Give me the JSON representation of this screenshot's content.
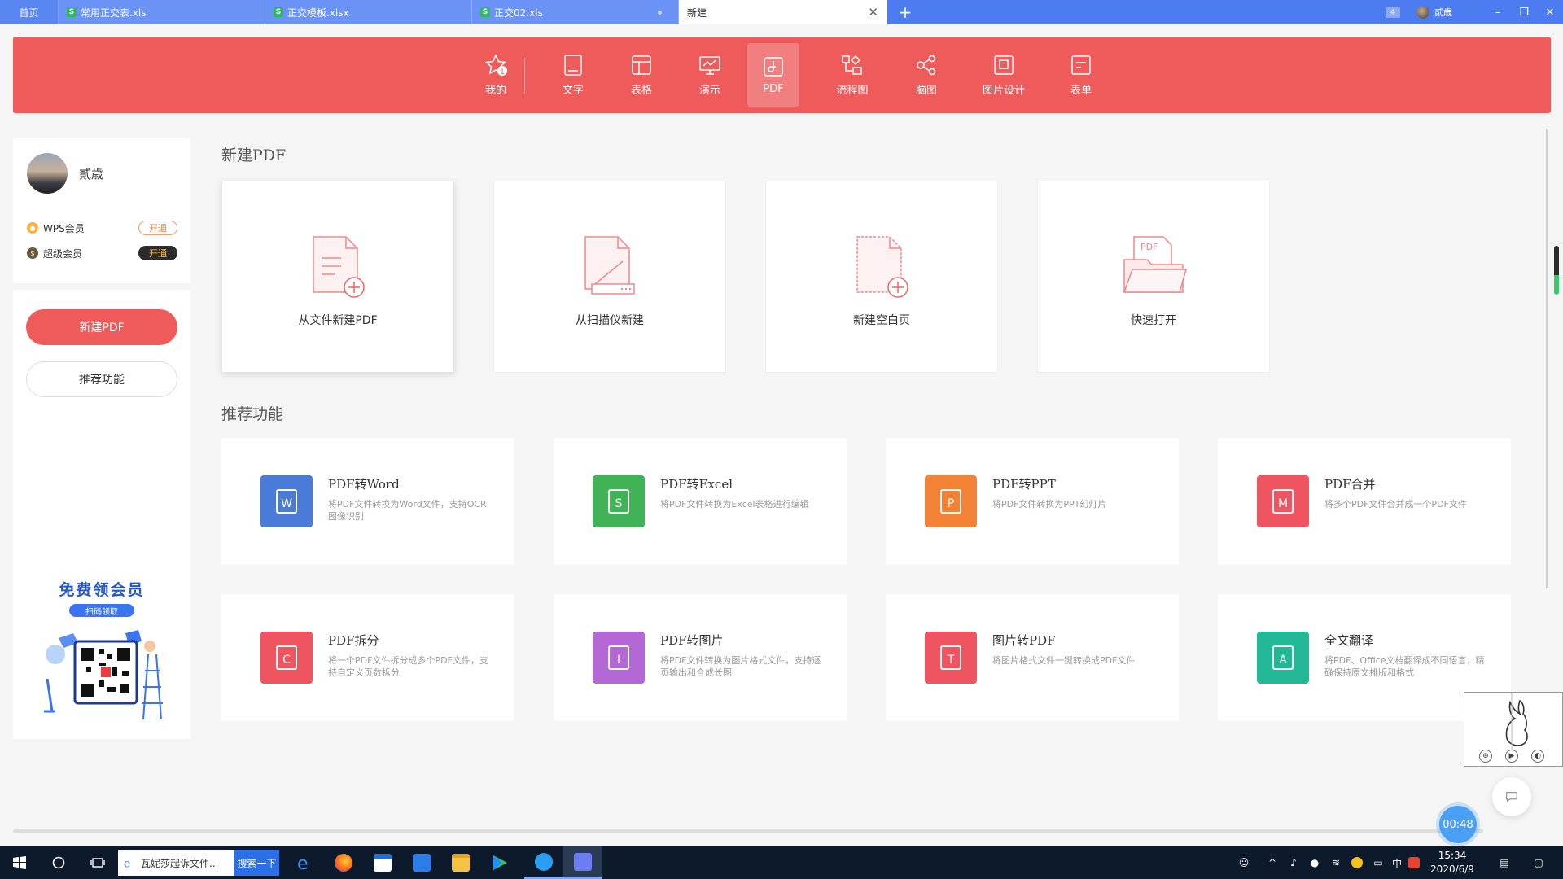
{
  "tabs": [
    {
      "label": "首页",
      "type": "home"
    },
    {
      "label": "常用正交表.xls",
      "type": "file",
      "icon": "S"
    },
    {
      "label": "正交模板.xlsx",
      "type": "file",
      "icon": "S"
    },
    {
      "label": "正交02.xls",
      "type": "file",
      "icon": "S"
    },
    {
      "label": "新建",
      "type": "active"
    }
  ],
  "window": {
    "badge": "4",
    "account": "貳歳"
  },
  "toolbar": {
    "items": [
      {
        "label": "我的",
        "icon": "star-user-icon",
        "badge": "1"
      },
      {
        "label": "文字",
        "icon": "doc-icon"
      },
      {
        "label": "表格",
        "icon": "table-icon"
      },
      {
        "label": "演示",
        "icon": "presentation-icon"
      },
      {
        "label": "PDF",
        "icon": "pdf-icon",
        "active": true
      },
      {
        "label": "流程图",
        "icon": "flowchart-icon"
      },
      {
        "label": "脑图",
        "icon": "mindmap-icon"
      },
      {
        "label": "图片设计",
        "icon": "image-design-icon"
      },
      {
        "label": "表单",
        "icon": "form-icon"
      }
    ]
  },
  "user": {
    "name": "貳歳",
    "memberships": [
      {
        "label": "WPS会员",
        "action": "开通"
      },
      {
        "label": "超级会员",
        "action": "开通"
      }
    ]
  },
  "sidebar": {
    "new_pdf": "新建PDF",
    "recommend": "推荐功能",
    "promo_title": "免费领会员",
    "promo_sub": "扫码领取"
  },
  "main": {
    "new_section_title": "新建PDF",
    "new_cards": [
      {
        "label": "从文件新建PDF",
        "icon": "file-add-icon"
      },
      {
        "label": "从扫描仪新建",
        "icon": "scanner-icon"
      },
      {
        "label": "新建空白页",
        "icon": "blank-page-add-icon"
      },
      {
        "label": "快速打开",
        "icon": "folder-pdf-icon",
        "icon_text": "PDF"
      }
    ],
    "func_section_title": "推荐功能",
    "functions": [
      {
        "title": "PDF转Word",
        "desc": "将PDF文件转换为Word文件，支持OCR图像识别",
        "color": "#4a7bd8",
        "icon_letter": "W"
      },
      {
        "title": "PDF转Excel",
        "desc": "将PDF文件转换为Excel表格进行编辑",
        "color": "#3fb356",
        "icon_letter": "S"
      },
      {
        "title": "PDF转PPT",
        "desc": "将PDF文件转换为PPT幻灯片",
        "color": "#f28336",
        "icon_letter": "P"
      },
      {
        "title": "PDF合并",
        "desc": "将多个PDF文件合并成一个PDF文件",
        "color": "#ef5560",
        "icon_letter": "M"
      },
      {
        "title": "PDF拆分",
        "desc": "将一个PDF文件拆分成多个PDF文件，支持自定义页数拆分",
        "color": "#ef5560",
        "icon_letter": "C"
      },
      {
        "title": "PDF转图片",
        "desc": "将PDF文件转换为图片格式文件，支持逐页输出和合成长图",
        "color": "#b368d6",
        "icon_letter": "I"
      },
      {
        "title": "图片转PDF",
        "desc": "将图片格式文件一键转换成PDF文件",
        "color": "#ef5560",
        "icon_letter": "T"
      },
      {
        "title": "全文翻译",
        "desc": "将PDF、Office文档翻译成不同语言，精确保持原文排版和格式",
        "color": "#22b896",
        "icon_letter": "A"
      }
    ]
  },
  "overlay": {
    "timer": "00:48"
  },
  "taskbar": {
    "search_text": "瓦妮莎起诉文件...",
    "search_button": "搜索一下",
    "ime": "中",
    "time": "15:34",
    "date": "2020/6/9"
  }
}
